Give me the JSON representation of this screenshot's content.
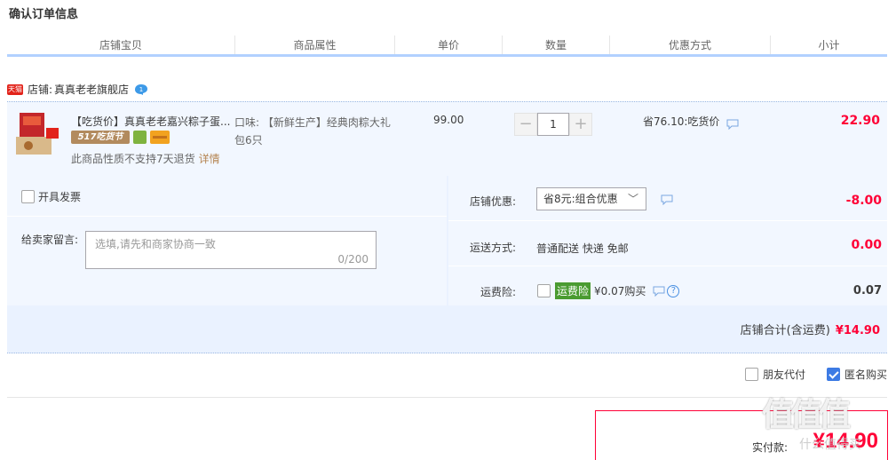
{
  "page": {
    "title": "确认订单信息"
  },
  "columns": [
    "店铺宝贝",
    "商品属性",
    "单价",
    "数量",
    "优惠方式",
    "小计"
  ],
  "shop": {
    "badge": "天猫",
    "label": "店铺:",
    "name": "真真老老旗舰店"
  },
  "item": {
    "title": "【吃货价】真真老老嘉兴粽子蛋...",
    "promo_tag": "517吃货节",
    "no_return": "此商品性质不支持7天退货",
    "detail_link": "详情",
    "props_line1": "口味: 【新鲜生产】经典肉粽大礼",
    "props_line2": "包6只",
    "unit_price": "99.00",
    "qty_minus": "−",
    "qty_value": "1",
    "qty_plus": "+",
    "discount": "省76.10:吃货价",
    "subtotal": "22.90"
  },
  "invoice": {
    "label": "开具发票"
  },
  "message": {
    "label": "给卖家留言:",
    "placeholder": "选填,请先和商家协商一致",
    "count": "0/200"
  },
  "shop_promo": {
    "label": "店铺优惠:",
    "selected": "省8元:组合优惠",
    "value": "-8.00"
  },
  "shipping": {
    "label": "运送方式:",
    "method": "普通配送 快递 免邮",
    "value": "0.00"
  },
  "insurance": {
    "label": "运费险:",
    "badge": "运费险",
    "price_text": "¥0.07购买",
    "value": "0.07"
  },
  "shop_total": {
    "label": "店铺合计(含运费)",
    "amount": "¥14.90"
  },
  "options": {
    "friend_pay": "朋友代付",
    "anonymous": "匿名购买"
  },
  "payment": {
    "label": "实付款:",
    "amount": "¥14.90"
  },
  "watermark": {
    "text": "值值值",
    "sub": "什么值得买"
  },
  "colors": {
    "accent_red": "#ff0036",
    "header_border": "#b2d1ff",
    "item_bg": "#f2f7ff"
  }
}
